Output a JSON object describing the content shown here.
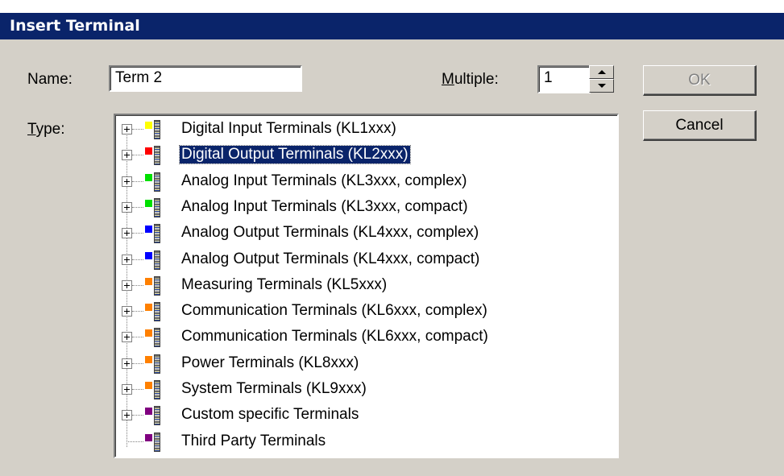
{
  "window": {
    "title": "Insert Terminal"
  },
  "form": {
    "name_label": "Name:",
    "name_value": "Term 2",
    "multiple_label_accel": "M",
    "multiple_label_rest": "ultiple:",
    "multiple_value": "1",
    "type_label_accel": "T",
    "type_label_rest": "ype:"
  },
  "buttons": {
    "ok": "OK",
    "cancel": "Cancel",
    "ok_enabled": false
  },
  "tree": {
    "selected_index": 1,
    "items": [
      {
        "label": "Digital Input Terminals (KL1xxx)",
        "color": "#ffff00",
        "expandable": true
      },
      {
        "label": "Digital Output Terminals (KL2xxx)",
        "color": "#ff0000",
        "expandable": true
      },
      {
        "label": "Analog Input Terminals (KL3xxx, complex)",
        "color": "#00e000",
        "expandable": true
      },
      {
        "label": "Analog Input Terminals (KL3xxx, compact)",
        "color": "#00e000",
        "expandable": true
      },
      {
        "label": "Analog Output Terminals (KL4xxx, complex)",
        "color": "#0000ff",
        "expandable": true
      },
      {
        "label": "Analog Output Terminals (KL4xxx, compact)",
        "color": "#0000ff",
        "expandable": true
      },
      {
        "label": "Measuring Terminals (KL5xxx)",
        "color": "#ff8000",
        "expandable": true
      },
      {
        "label": "Communication Terminals (KL6xxx, complex)",
        "color": "#ff8000",
        "expandable": true
      },
      {
        "label": "Communication Terminals (KL6xxx, compact)",
        "color": "#ff8000",
        "expandable": true
      },
      {
        "label": "Power Terminals (KL8xxx)",
        "color": "#ff8000",
        "expandable": true
      },
      {
        "label": "System Terminals (KL9xxx)",
        "color": "#ff8000",
        "expandable": true
      },
      {
        "label": "Custom specific Terminals",
        "color": "#800080",
        "expandable": true
      },
      {
        "label": "Third Party Terminals",
        "color": "#800080",
        "expandable": false
      }
    ]
  }
}
